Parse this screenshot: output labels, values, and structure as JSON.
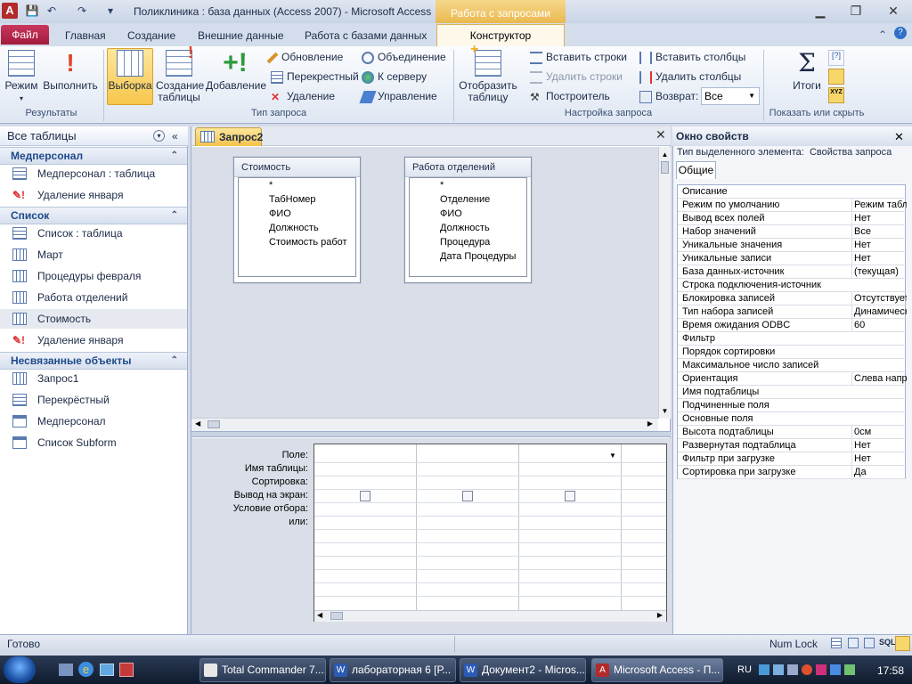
{
  "window": {
    "title": "Поликлиника : база данных (Access 2007)  -  Microsoft Access",
    "context_tab_header": "Работа с запросами",
    "app_icon_letter": "A"
  },
  "tabs": {
    "file": "Файл",
    "home": "Главная",
    "create": "Создание",
    "external": "Внешние данные",
    "db_tools": "Работа с базами данных",
    "constructor": "Конструктор"
  },
  "ribbon": {
    "results": {
      "mode": "Режим",
      "run": "Выполнить",
      "label": "Результаты"
    },
    "query_type": {
      "select": "Выборка",
      "make_table_1": "Создание",
      "make_table_2": "таблицы",
      "append": "Добавление",
      "update": "Обновление",
      "crosstab": "Перекрестный",
      "delete": "Удаление",
      "union": "Объединение",
      "to_server": "К серверу",
      "manage": "Управление",
      "label": "Тип запроса"
    },
    "setup": {
      "show_table_1": "Отобразить",
      "show_table_2": "таблицу",
      "insert_rows": "Вставить строки",
      "delete_rows": "Удалить строки",
      "builder": "Построитель",
      "insert_cols": "Вставить столбцы",
      "delete_cols": "Удалить столбцы",
      "return_label": "Возврат:",
      "return_value": "Все",
      "label": "Настройка запроса"
    },
    "show_hide": {
      "totals": "Итоги",
      "label": "Показать или скрыть",
      "sigma": "Σ"
    }
  },
  "nav": {
    "header": "Все таблицы",
    "groups": [
      {
        "title": "Медперсонал",
        "items": [
          "Медперсонал : таблица",
          "Удаление января"
        ]
      },
      {
        "title": "Список",
        "items": [
          "Список : таблица",
          "Март",
          "Процедуры февраля",
          "Работа отделений",
          "Стоимость",
          "Удаление января"
        ]
      },
      {
        "title": "Несвязанные объекты",
        "items": [
          "Запрос1",
          "Перекрёстный",
          "Медперсонал",
          "Список Subform"
        ]
      }
    ]
  },
  "document": {
    "tab": "Запрос2",
    "tables": [
      {
        "title": "Стоимость",
        "fields": [
          "*",
          "ТабНомер",
          "ФИО",
          "Должность",
          "Стоимость работ"
        ]
      },
      {
        "title": "Работа отделений",
        "fields": [
          "*",
          "Отделение",
          "ФИО",
          "Должность",
          "Процедура",
          "Дата Процедуры"
        ]
      }
    ],
    "grid_labels": [
      "Поле:",
      "Имя таблицы:",
      "Сортировка:",
      "Вывод на экран:",
      "Условие отбора:",
      "или:"
    ]
  },
  "properties": {
    "title": "Окно свойств",
    "selection_type_label": "Тип выделенного элемента:",
    "selection_type_value": "Свойства запроса",
    "tab": "Общие",
    "rows": [
      {
        "name": "Описание",
        "value": ""
      },
      {
        "name": "Режим по умолчанию",
        "value": "Режим табл"
      },
      {
        "name": "Вывод всех полей",
        "value": "Нет"
      },
      {
        "name": "Набор значений",
        "value": "Все"
      },
      {
        "name": "Уникальные значения",
        "value": "Нет"
      },
      {
        "name": "Уникальные записи",
        "value": "Нет"
      },
      {
        "name": "База данных-источник",
        "value": "(текущая)"
      },
      {
        "name": "Строка подключения-источник",
        "value": ""
      },
      {
        "name": "Блокировка записей",
        "value": "Отсутствует"
      },
      {
        "name": "Тип набора записей",
        "value": "Динамический"
      },
      {
        "name": "Время ожидания ODBC",
        "value": "60"
      },
      {
        "name": "Фильтр",
        "value": ""
      },
      {
        "name": "Порядок сортировки",
        "value": ""
      },
      {
        "name": "Максимальное число записей",
        "value": ""
      },
      {
        "name": "Ориентация",
        "value": "Слева напр"
      },
      {
        "name": "Имя подтаблицы",
        "value": ""
      },
      {
        "name": "Подчиненные поля",
        "value": ""
      },
      {
        "name": "Основные поля",
        "value": ""
      },
      {
        "name": "Высота подтаблицы",
        "value": "0см"
      },
      {
        "name": "Развернутая подтаблица",
        "value": "Нет"
      },
      {
        "name": "Фильтр при загрузке",
        "value": "Нет"
      },
      {
        "name": "Сортировка при загрузке",
        "value": "Да"
      }
    ]
  },
  "status": {
    "text": "Готово",
    "numlock": "Num Lock"
  },
  "taskbar": {
    "buttons": [
      "Total Commander 7....",
      "лабораторная 6 [Р...",
      "Документ2 - Micros...",
      "Microsoft Access - П..."
    ],
    "lang": "RU",
    "clock": "17:58"
  },
  "colors": {
    "accent_file": "#a21b3d",
    "context": "#f3c24b",
    "nav_group": "#1d4a8a"
  }
}
